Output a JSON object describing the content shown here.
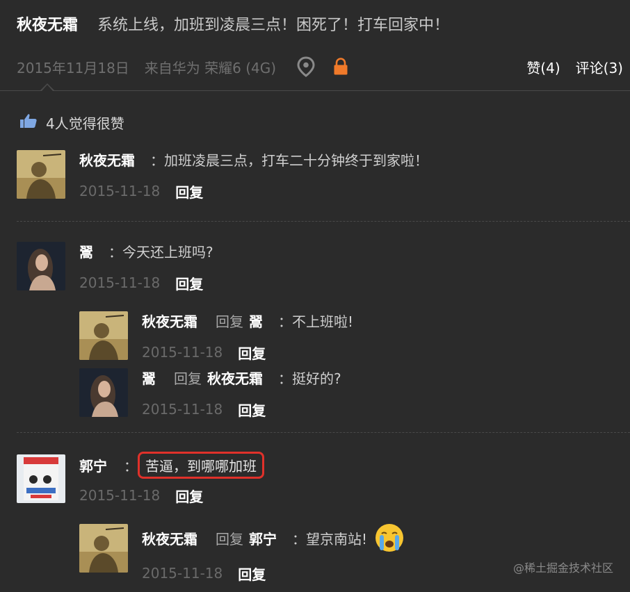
{
  "post": {
    "author": "秋夜无霜",
    "content": "系统上线，加班到凌晨三点！困死了！打车回家中！",
    "date": "2015年11月18日",
    "source": "来自华为 荣耀6 (4G)",
    "likes_label": "赞(4)",
    "comments_label": "评论(3)"
  },
  "likes_summary": "4人觉得很赞",
  "comments": [
    {
      "name": "秋夜无霜",
      "text": "：加班凌晨三点，打车二十分钟终于到家啦！",
      "date": "2015-11-18",
      "reply_label": "回复"
    },
    {
      "name": "翯",
      "text": "：今天还上班吗?",
      "date": "2015-11-18",
      "reply_label": "回复",
      "replies": [
        {
          "name": "秋夜无霜",
          "reply_word": "回复",
          "target": "翯",
          "text": "：不上班啦!",
          "date": "2015-11-18",
          "reply_label": "回复"
        },
        {
          "name": "翯",
          "reply_word": "回复",
          "target": "秋夜无霜",
          "text": "：挺好的?",
          "date": "2015-11-18",
          "reply_label": "回复"
        }
      ]
    },
    {
      "name": "郭宁",
      "text": "苦逼，到哪哪加班",
      "text_prefix": "：",
      "date": "2015-11-18",
      "reply_label": "回复",
      "replies": [
        {
          "name": "秋夜无霜",
          "reply_word": "回复",
          "target": "郭宁",
          "text": "：望京南站!",
          "date": "2015-11-18",
          "reply_label": "回复"
        }
      ]
    }
  ],
  "watermark": "@稀土掘金技术社区",
  "colors": {
    "background": "#2b2b2b",
    "lock_icon": "#f07a2a",
    "highlight_border": "#e0312a"
  }
}
